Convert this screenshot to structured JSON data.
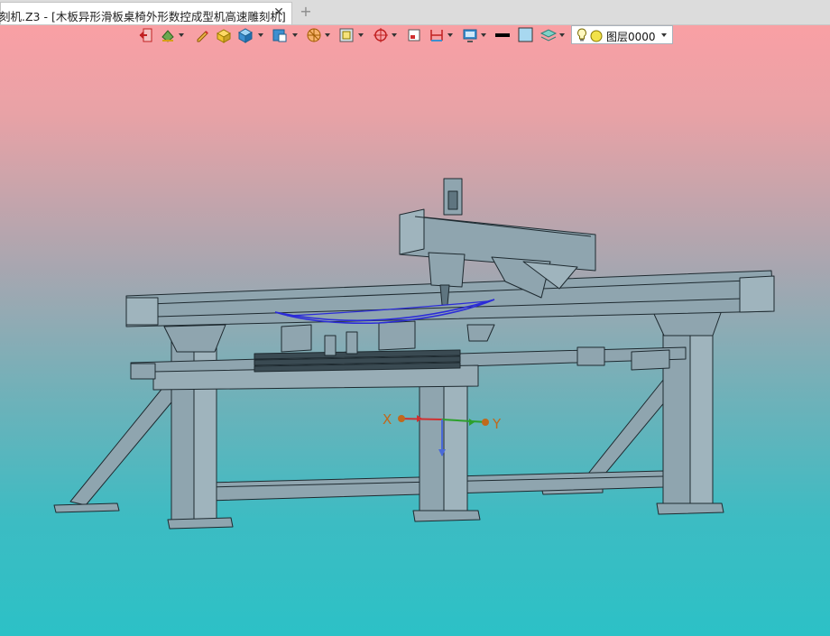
{
  "tab": {
    "title": "刻机.Z3 - [木板异形滑板桌椅外形数控成型机高速雕刻机]",
    "close_glyph": "✕",
    "new_tab_glyph": "+"
  },
  "toolbar": {
    "icons": [
      "exit-icon",
      "paint-bucket-icon",
      "pencil-icon",
      "box-shaded-icon",
      "cube-icon",
      "view-cube-icon",
      "section-view-icon",
      "zoom-fit-icon",
      "orbit-icon",
      "frame-icon",
      "dimension-icon",
      "display-mode-icon",
      "line-color-icon",
      "fill-color-icon",
      "layer-stack-icon"
    ],
    "colors": {
      "line_color": "#000000",
      "fill_color": "#a8d8f0"
    }
  },
  "layer": {
    "selected": "图层0000"
  },
  "triad": {
    "x_label": "X",
    "y_label": "Y",
    "x_color": "#c0691c",
    "y_color": "#c0691c"
  },
  "viewport": {
    "model_color": "#8fa5af",
    "edge_color": "#1e2a30",
    "curve_color": "#2b2bd8"
  }
}
